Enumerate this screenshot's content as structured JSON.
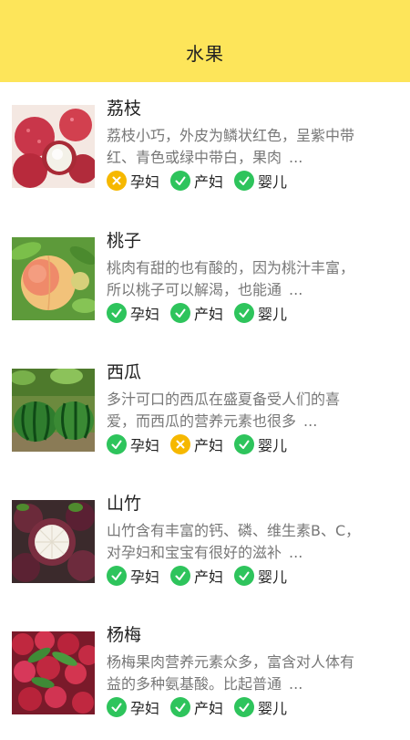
{
  "header": {
    "title": "水果"
  },
  "colors": {
    "header_bg": "#fde55a",
    "ok": "#2ec45c",
    "no": "#f6b800"
  },
  "items": [
    {
      "name": "荔枝",
      "desc1": "荔枝小巧，外皮为鳞状红色，呈紫中带",
      "desc2": "红、青色或绿中带白，果肉",
      "ellipsis": "...",
      "image": "lychee",
      "tags": [
        {
          "label": "孕妇",
          "status": "no"
        },
        {
          "label": "产妇",
          "status": "ok"
        },
        {
          "label": "婴儿",
          "status": "ok"
        }
      ]
    },
    {
      "name": "桃子",
      "desc1": "桃肉有甜的也有酸的，因为桃汁丰富，",
      "desc2": "所以桃子可以解渴，也能通",
      "ellipsis": "...",
      "image": "peach",
      "tags": [
        {
          "label": "孕妇",
          "status": "ok"
        },
        {
          "label": "产妇",
          "status": "ok"
        },
        {
          "label": "婴儿",
          "status": "ok"
        }
      ]
    },
    {
      "name": "西瓜",
      "desc1": "多汁可口的西瓜在盛夏备受人们的喜",
      "desc2": "爱，而西瓜的营养元素也很多",
      "ellipsis": "...",
      "image": "watermelon",
      "tags": [
        {
          "label": "孕妇",
          "status": "ok"
        },
        {
          "label": "产妇",
          "status": "no"
        },
        {
          "label": "婴儿",
          "status": "ok"
        }
      ]
    },
    {
      "name": "山竹",
      "desc1": "山竹含有丰富的钙、磷、维生素B、C，",
      "desc2": "对孕妇和宝宝有很好的滋补",
      "ellipsis": "...",
      "image": "mangosteen",
      "tags": [
        {
          "label": "孕妇",
          "status": "ok"
        },
        {
          "label": "产妇",
          "status": "ok"
        },
        {
          "label": "婴儿",
          "status": "ok"
        }
      ]
    },
    {
      "name": "杨梅",
      "desc1": "杨梅果肉营养元素众多，富含对人体有",
      "desc2": "益的多种氨基酸。比起普通",
      "ellipsis": "...",
      "image": "bayberry",
      "tags": [
        {
          "label": "孕妇",
          "status": "ok"
        },
        {
          "label": "产妇",
          "status": "ok"
        },
        {
          "label": "婴儿",
          "status": "ok"
        }
      ]
    }
  ]
}
